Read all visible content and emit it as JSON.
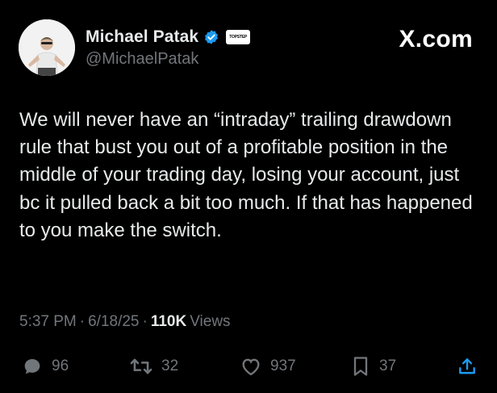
{
  "author": {
    "display_name": "Michael Patak",
    "handle": "@MichaelPatak",
    "affiliate_badge": "TOPSTEP",
    "verified_color": "#1d9bf0"
  },
  "brand": "X.com",
  "tweet": {
    "text": "We will never have an “intraday” trailing drawdown rule that bust you out of a profitable position in the middle of your trading day, losing your account, just bc it pulled back a bit too much. If that has happened to you make the switch."
  },
  "meta": {
    "time": "5:37 PM",
    "separator": "·",
    "date": "6/18/25",
    "views_count": "110K",
    "views_label": "Views"
  },
  "actions": {
    "replies": "96",
    "reposts": "32",
    "likes": "937",
    "bookmarks": "37"
  },
  "icons": [
    "reply-icon",
    "repost-icon",
    "like-icon",
    "bookmark-icon",
    "share-icon",
    "verified-icon"
  ]
}
